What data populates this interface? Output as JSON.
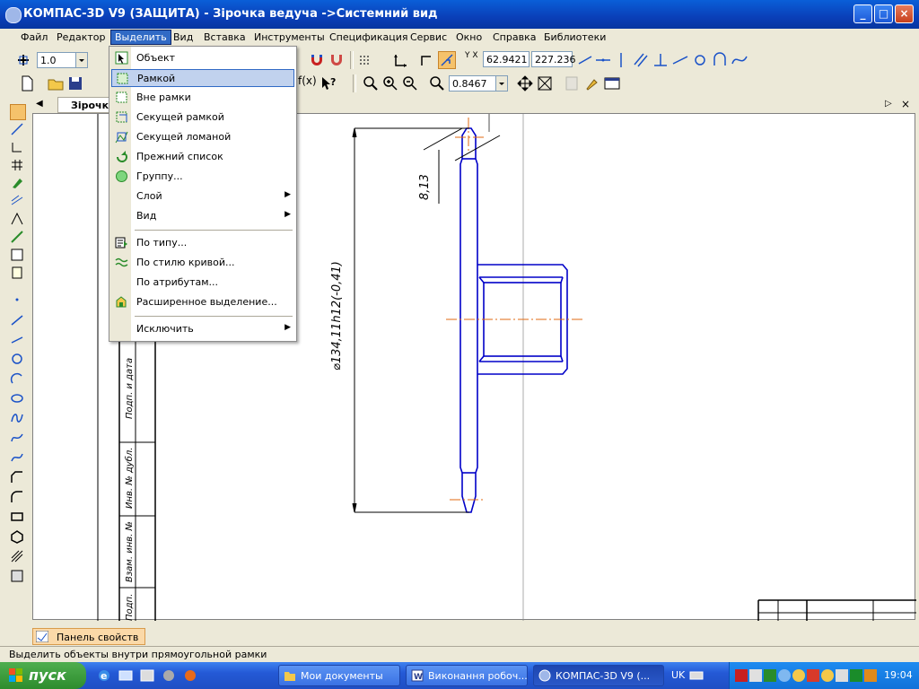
{
  "window": {
    "title": "КОМПАС-3D V9 (ЗАЩИТА) - Зірочка ведуча ->Системний вид",
    "minimize": "_",
    "maximize": "□",
    "close": "×"
  },
  "menu": {
    "items": [
      "Файл",
      "Редактор",
      "Выделить",
      "Вид",
      "Вставка",
      "Инструменты",
      "Спецификация",
      "Сервис",
      "Окно",
      "Справка",
      "Библиотеки"
    ],
    "active_index": 2
  },
  "toolbar": {
    "scale_value": "1.0",
    "coord_x": "62.9421",
    "coord_y": "227.236",
    "zoom_value": "0.8467",
    "xy_label": "Y X"
  },
  "document": {
    "tab_title": "Зірочка"
  },
  "dropdown": {
    "items": [
      {
        "label": "Объект",
        "icon": "object-select-icon",
        "submenu": false
      },
      {
        "label": "Рамкой",
        "icon": "frame-select-icon",
        "submenu": false
      },
      {
        "label": "Вне рамки",
        "icon": "outside-frame-icon",
        "submenu": false
      },
      {
        "label": "Секущей рамкой",
        "icon": "crossing-frame-icon",
        "submenu": false
      },
      {
        "label": "Секущей ломаной",
        "icon": "crossing-polyline-icon",
        "submenu": false
      },
      {
        "label": "Прежний список",
        "icon": "previous-list-icon",
        "submenu": false
      },
      {
        "label": "Группу...",
        "icon": "group-icon",
        "submenu": false
      },
      {
        "label": "Слой",
        "icon": "",
        "submenu": true
      },
      {
        "label": "Вид",
        "icon": "",
        "submenu": true
      },
      {
        "label": "По типу...",
        "icon": "by-type-icon",
        "submenu": false
      },
      {
        "label": "По стилю кривой...",
        "icon": "by-curve-style-icon",
        "submenu": false
      },
      {
        "label": "По атрибутам...",
        "icon": "by-attributes-icon",
        "submenu": false
      },
      {
        "label": "Расширенное выделение...",
        "icon": "extended-select-icon",
        "submenu": false
      },
      {
        "label": "Исключить",
        "icon": "",
        "submenu": true
      }
    ],
    "highlighted_index": 1
  },
  "drawing": {
    "dim_top": "8,13",
    "dim_diameter": "⌀134,11h12(-0,41)",
    "stamp_labels": [
      "Подп. и дата",
      "Инв. № дубл.",
      "Взам. инв. №",
      "Подп."
    ]
  },
  "properties_panel": {
    "tab_label": "Панель свойств"
  },
  "status": {
    "text": "Выделить объекты внутри прямоугольной рамки"
  },
  "taskbar": {
    "start_label": "пуск",
    "items": [
      {
        "label": "Мои документы",
        "active": false
      },
      {
        "label": "Виконання робоч...",
        "active": false
      },
      {
        "label": "КОМПАС-3D V9 (...",
        "active": true
      }
    ],
    "language": "UK",
    "clock": "19:04"
  }
}
